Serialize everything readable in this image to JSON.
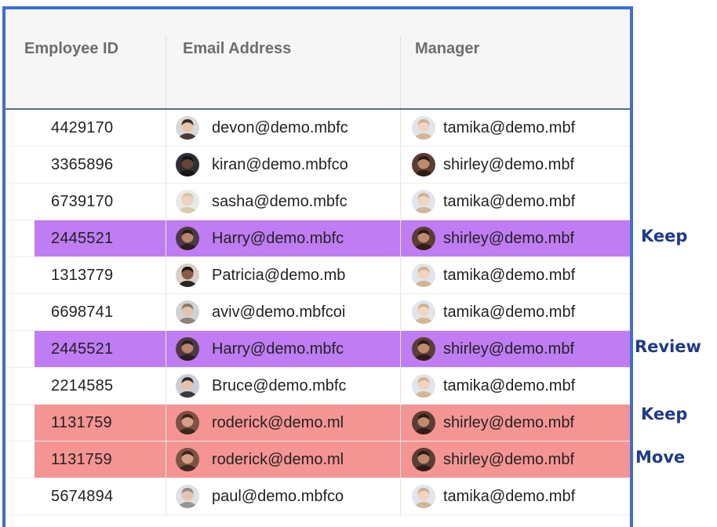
{
  "columns": {
    "employee_id": "Employee ID",
    "email": "Email Address",
    "manager": "Manager"
  },
  "rows": [
    {
      "id": "4429170",
      "email": "devon@demo.mbfc",
      "manager": "tamika@demo.mbf",
      "highlight": "none",
      "avatar": "man-glasses-beard",
      "mgr_avatar": "woman-light-hair"
    },
    {
      "id": "3365896",
      "email": "kiran@demo.mbfco",
      "manager": "shirley@demo.mbf",
      "highlight": "none",
      "avatar": "dark-man",
      "mgr_avatar": "woman-dark-hair"
    },
    {
      "id": "6739170",
      "email": "sasha@demo.mbfc",
      "manager": "tamika@demo.mbf",
      "highlight": "none",
      "avatar": "woman-blonde",
      "mgr_avatar": "woman-light-hair"
    },
    {
      "id": "2445521",
      "email": "Harry@demo.mbfc",
      "manager": "shirley@demo.mbf",
      "highlight": "purple",
      "avatar": "man-dark-beard",
      "mgr_avatar": "woman-dark-hair"
    },
    {
      "id": "1313779",
      "email": "Patricia@demo.mb",
      "manager": "tamika@demo.mbf",
      "highlight": "none",
      "avatar": "woman-curly",
      "mgr_avatar": "woman-light-hair"
    },
    {
      "id": "6698741",
      "email": "aviv@demo.mbfcoi",
      "manager": "tamika@demo.mbf",
      "highlight": "none",
      "avatar": "man-suit",
      "mgr_avatar": "woman-light-hair"
    },
    {
      "id": "2445521",
      "email": "Harry@demo.mbfc",
      "manager": "shirley@demo.mbf",
      "highlight": "purple",
      "avatar": "man-dark-beard",
      "mgr_avatar": "woman-dark-hair"
    },
    {
      "id": "2214585",
      "email": "Bruce@demo.mbfc",
      "manager": "tamika@demo.mbf",
      "highlight": "none",
      "avatar": "man-glasses",
      "mgr_avatar": "woman-light-hair"
    },
    {
      "id": "1131759",
      "email": "roderick@demo.ml",
      "manager": "shirley@demo.mbf",
      "highlight": "red",
      "avatar": "man-bald-beard",
      "mgr_avatar": "woman-dark-hair"
    },
    {
      "id": "1131759",
      "email": "roderick@demo.ml",
      "manager": "shirley@demo.mbf",
      "highlight": "red",
      "avatar": "man-bald-beard",
      "mgr_avatar": "woman-dark-hair"
    },
    {
      "id": "5674894",
      "email": "paul@demo.mbfco",
      "manager": "tamika@demo.mbf",
      "highlight": "none",
      "avatar": "man-gray",
      "mgr_avatar": "woman-light-hair"
    }
  ],
  "annotations": [
    {
      "text": "Keep",
      "row": 3
    },
    {
      "text": "Review",
      "row": 6
    },
    {
      "text": "Keep",
      "row": 8
    },
    {
      "text": "Move",
      "row": 9
    }
  ],
  "colors": {
    "border": "#3b6fd8",
    "highlight_purple": "#c07cf2",
    "highlight_red": "#f49593",
    "annotation": "#1e3a8a"
  }
}
